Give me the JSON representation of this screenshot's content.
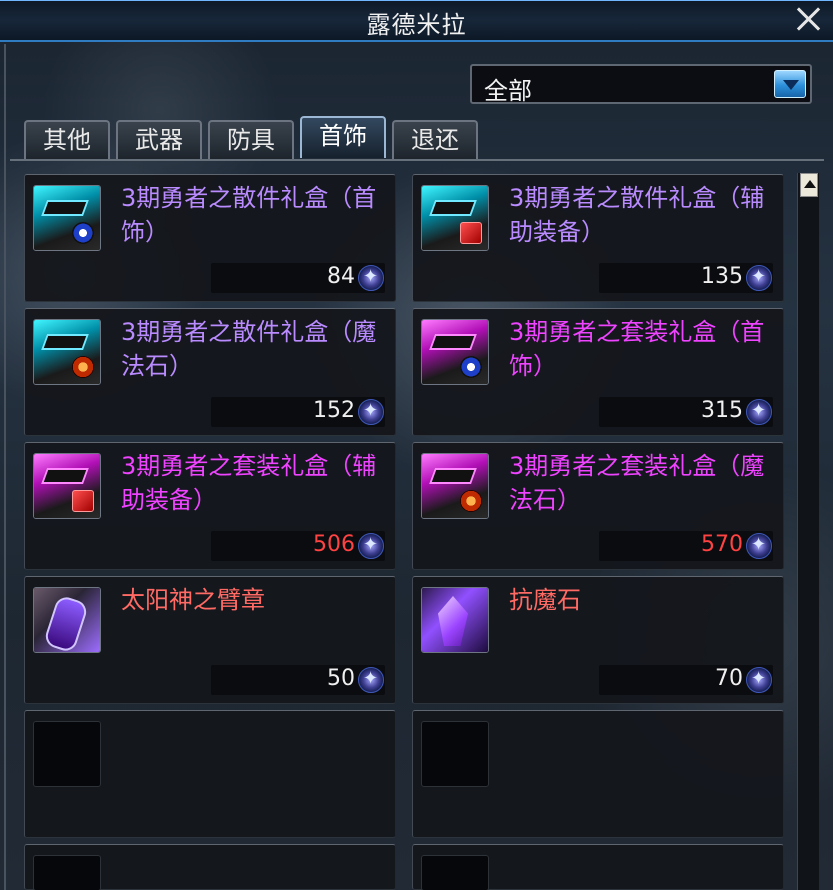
{
  "window": {
    "title": "露德米拉"
  },
  "filter": {
    "selected": "全部"
  },
  "tabs": [
    {
      "label": "其他"
    },
    {
      "label": "武器"
    },
    {
      "label": "防具"
    },
    {
      "label": "首饰"
    },
    {
      "label": "退还"
    }
  ],
  "items": [
    {
      "name": "3期勇者之散件礼盒（首饰）",
      "price": "84",
      "name_color": "purple",
      "price_color": "white",
      "icon": "gift-box-cyan-ring-icon"
    },
    {
      "name": "3期勇者之散件礼盒（辅助装备）",
      "price": "135",
      "name_color": "purple",
      "price_color": "white",
      "icon": "gift-box-cyan-card-icon"
    },
    {
      "name": "3期勇者之散件礼盒（魔法石）",
      "price": "152",
      "name_color": "purple",
      "price_color": "white",
      "icon": "gift-box-cyan-stone-icon"
    },
    {
      "name": "3期勇者之套装礼盒（首饰）",
      "price": "315",
      "name_color": "magenta",
      "price_color": "white",
      "icon": "gift-box-purple-ring-icon"
    },
    {
      "name": "3期勇者之套装礼盒（辅助装备）",
      "price": "506",
      "name_color": "magenta",
      "price_color": "red",
      "icon": "gift-box-purple-card-icon"
    },
    {
      "name": "3期勇者之套装礼盒（魔法石）",
      "price": "570",
      "name_color": "magenta",
      "price_color": "red",
      "icon": "gift-box-purple-stone-icon"
    },
    {
      "name": "太阳神之臂章",
      "price": "50",
      "name_color": "orange",
      "price_color": "white",
      "icon": "armband-icon"
    },
    {
      "name": "抗魔石",
      "price": "70",
      "name_color": "orange",
      "price_color": "white",
      "icon": "crystal-icon"
    }
  ],
  "scroll": {
    "up_icon": "scroll-up-icon"
  },
  "colors": {
    "purple_text": "#b98bff",
    "magenta_text": "#ee43ff",
    "orange_text": "#ff6a64",
    "red_price": "#ff4242",
    "tab_active": "#9cb7d4"
  }
}
